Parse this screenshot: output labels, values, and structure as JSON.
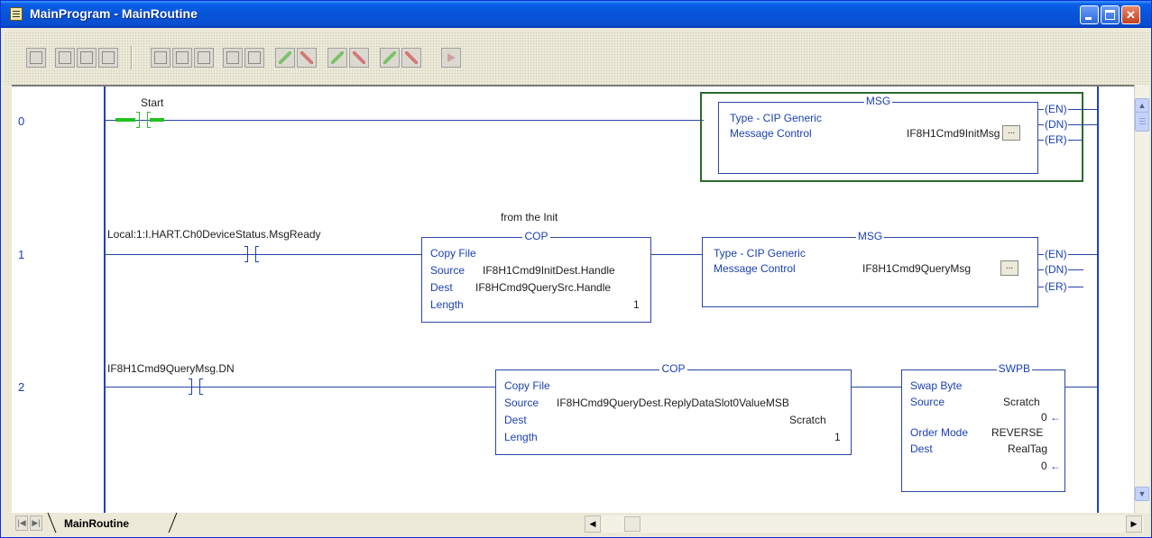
{
  "window": {
    "title": "MainProgram - MainRoutine",
    "minimize": "_",
    "maximize": "□",
    "close": "✕"
  },
  "toolbar": {
    "icons": [
      "rung-icon",
      "new-rung-icon",
      "new-branch-icon",
      "branch-level-icon",
      "xic-icon",
      "xio-icon",
      "ote-icon",
      "otl-icon",
      "otu-icon",
      "accept-edit-icon",
      "cancel-edit-icon",
      "accept-pending-icon",
      "cancel-pending-icon",
      "assemble-icon",
      "cancel-assemble-icon",
      "test-edits-icon"
    ]
  },
  "rungs": [
    {
      "number": "0",
      "contact": {
        "tag": "Start"
      },
      "msg": {
        "header": "MSG",
        "type_label": "Type - CIP Generic",
        "control_label": "Message Control",
        "control_value": "IF8H1Cmd9InitMsg",
        "button": "...",
        "outputs": [
          "EN",
          "DN",
          "ER"
        ]
      }
    },
    {
      "number": "1",
      "comment": "from the Init",
      "contact": {
        "tag": "Local:1:I.HART.Ch0DeviceStatus.MsgReady"
      },
      "cop": {
        "header": "COP",
        "title": "Copy File",
        "source_label": "Source",
        "source_value": "IF8H1Cmd9InitDest.Handle",
        "dest_label": "Dest",
        "dest_value": "IF8HCmd9QuerySrc.Handle",
        "length_label": "Length",
        "length_value": "1"
      },
      "msg": {
        "header": "MSG",
        "type_label": "Type - CIP Generic",
        "control_label": "Message Control",
        "control_value": "IF8H1Cmd9QueryMsg",
        "button": "...",
        "outputs": [
          "EN",
          "DN",
          "ER"
        ]
      }
    },
    {
      "number": "2",
      "contact": {
        "tag": "IF8H1Cmd9QueryMsg.DN"
      },
      "cop": {
        "header": "COP",
        "title": "Copy File",
        "source_label": "Source",
        "source_value": "IF8HCmd9QueryDest.ReplyDataSlot0ValueMSB",
        "dest_label": "Dest",
        "dest_value": "Scratch",
        "length_label": "Length",
        "length_value": "1"
      },
      "swpb": {
        "header": "SWPB",
        "title": "Swap Byte",
        "source_label": "Source",
        "source_value": "Scratch",
        "source_live": "0",
        "order_label": "Order Mode",
        "order_value": "REVERSE",
        "dest_label": "Dest",
        "dest_value": "RealTag",
        "dest_live": "0",
        "arrow": "←"
      }
    }
  ],
  "tabs": {
    "active": "MainRoutine",
    "first": "|◀",
    "next": "▶|"
  },
  "scroll": {
    "up": "▲",
    "down": "▼",
    "left": "◀",
    "right": "▶"
  }
}
